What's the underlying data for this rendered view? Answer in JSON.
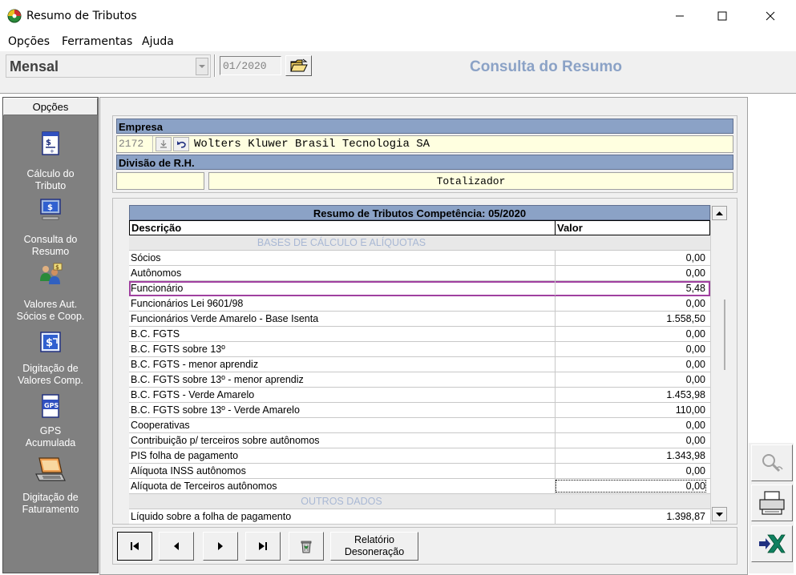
{
  "window": {
    "title": "Resumo de Tributos"
  },
  "menu": {
    "items": [
      "Opções",
      "Ferramentas",
      "Ajuda"
    ]
  },
  "toolbar": {
    "period_select": "Mensal",
    "date_value": "01/2020",
    "page_title": "Consulta do Resumo"
  },
  "sidebar": {
    "header": "Opções",
    "items": [
      {
        "label_1": "Cálculo do",
        "label_2": "Tributo"
      },
      {
        "label_1": "Consulta do",
        "label_2": "Resumo"
      },
      {
        "label_1": "Valores Aut.",
        "label_2": "Sócios e  Coop."
      },
      {
        "label_1": "Digitação de",
        "label_2": "Valores Comp."
      },
      {
        "label_1": "GPS",
        "label_2": "Acumulada",
        "icon_text": "GPS"
      },
      {
        "label_1": "Digitação de",
        "label_2": "Faturamento"
      }
    ]
  },
  "empresa": {
    "label": "Empresa",
    "code": "2172",
    "name": "Wolters Kluwer Brasil Tecnologia SA",
    "division_label": "Divisão de R.H.",
    "division_value": "Totalizador"
  },
  "grid": {
    "caption": "Resumo de Tributos Competência: 05/2020",
    "col_desc": "Descrição",
    "col_valor": "Valor",
    "rows": [
      {
        "desc": "BASES DE CÁLCULO E ALÍQUOTAS",
        "val": "",
        "type": "section"
      },
      {
        "desc": "Sócios",
        "val": "0,00"
      },
      {
        "desc": "Autônomos",
        "val": "0,00"
      },
      {
        "desc": "Funcionário",
        "val": "5,48",
        "type": "hl"
      },
      {
        "desc": "Funcionários Lei 9601/98",
        "val": "0,00"
      },
      {
        "desc": "Funcionários Verde Amarelo - Base Isenta",
        "val": "1.558,50"
      },
      {
        "desc": "B.C. FGTS",
        "val": "0,00"
      },
      {
        "desc": "B.C. FGTS sobre 13º",
        "val": "0,00"
      },
      {
        "desc": "B.C. FGTS - menor aprendiz",
        "val": "0,00"
      },
      {
        "desc": "B.C. FGTS sobre 13º - menor aprendiz",
        "val": "0,00"
      },
      {
        "desc": "B.C. FGTS - Verde Amarelo",
        "val": "1.453,98"
      },
      {
        "desc": "B.C. FGTS sobre 13º - Verde Amarelo",
        "val": "110,00"
      },
      {
        "desc": "Cooperativas",
        "val": "0,00"
      },
      {
        "desc": "Contribuição p/ terceiros sobre autônomos",
        "val": "0,00"
      },
      {
        "desc": "PIS folha de pagamento",
        "val": "1.343,98"
      },
      {
        "desc": "Alíquota INSS autônomos",
        "val": "0,00"
      },
      {
        "desc": "Alíquota de Terceiros autônomos",
        "val": "0,00",
        "type": "focus"
      },
      {
        "desc": "OUTROS DADOS",
        "val": "",
        "type": "section"
      },
      {
        "desc": "Líquido sobre a folha de pagamento",
        "val": "1.398,87"
      }
    ]
  },
  "nav": {
    "report_line1": "Relatório",
    "report_line2": "Desoneração"
  }
}
